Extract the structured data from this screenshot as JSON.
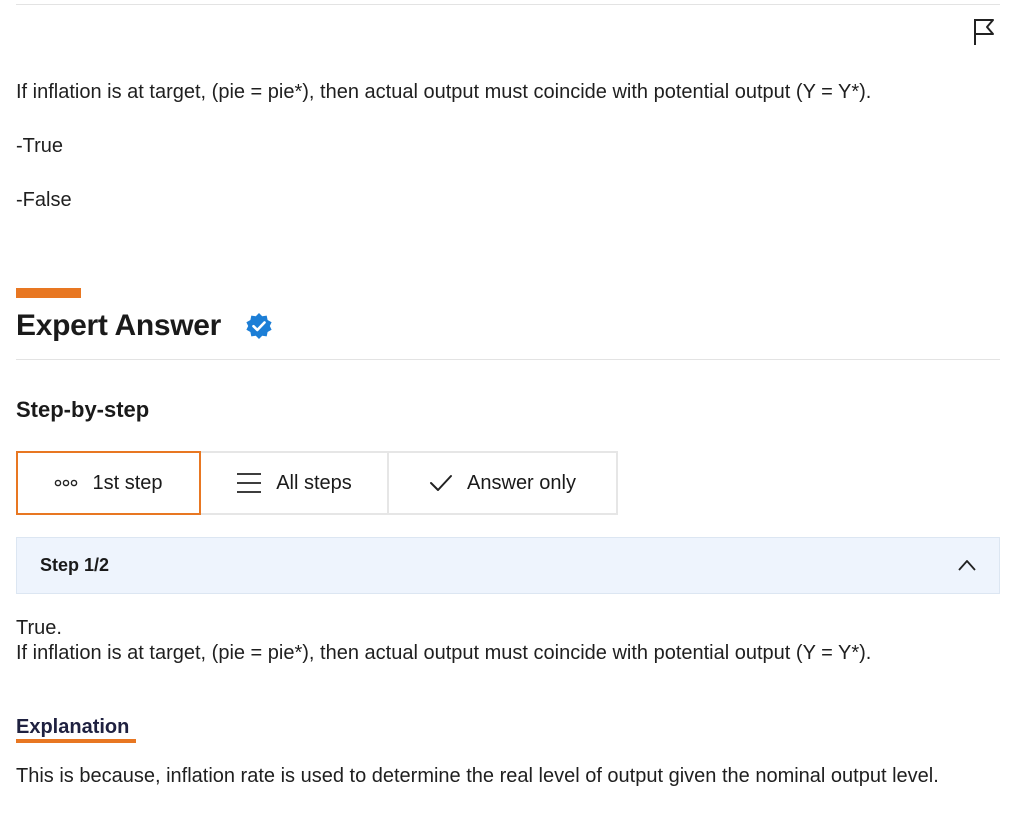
{
  "question": {
    "text": "If inflation is at target, (pie = pie*), then actual output must coincide with potential output (Y = Y*).",
    "options": [
      "-True",
      "-False"
    ]
  },
  "expert": {
    "title": "Expert Answer"
  },
  "steps": {
    "heading": "Step-by-step",
    "tabs": [
      {
        "label": "1st step",
        "icon": "dots-icon",
        "selected": true
      },
      {
        "label": "All steps",
        "icon": "list-icon",
        "selected": false
      },
      {
        "label": "Answer only",
        "icon": "check-icon",
        "selected": false
      }
    ],
    "current": "Step 1/2"
  },
  "answer": {
    "line1": "True.",
    "line2": "If inflation is at target, (pie = pie*), then actual output must coincide with potential output (Y = Y*)."
  },
  "explanation": {
    "title": "Explanation",
    "body": "This is because, inflation rate is used to determine the real level of output given the nominal output level."
  },
  "colors": {
    "accent": "#e87722",
    "verified": "#1c7ed6",
    "step_bg": "#eef4fd"
  }
}
